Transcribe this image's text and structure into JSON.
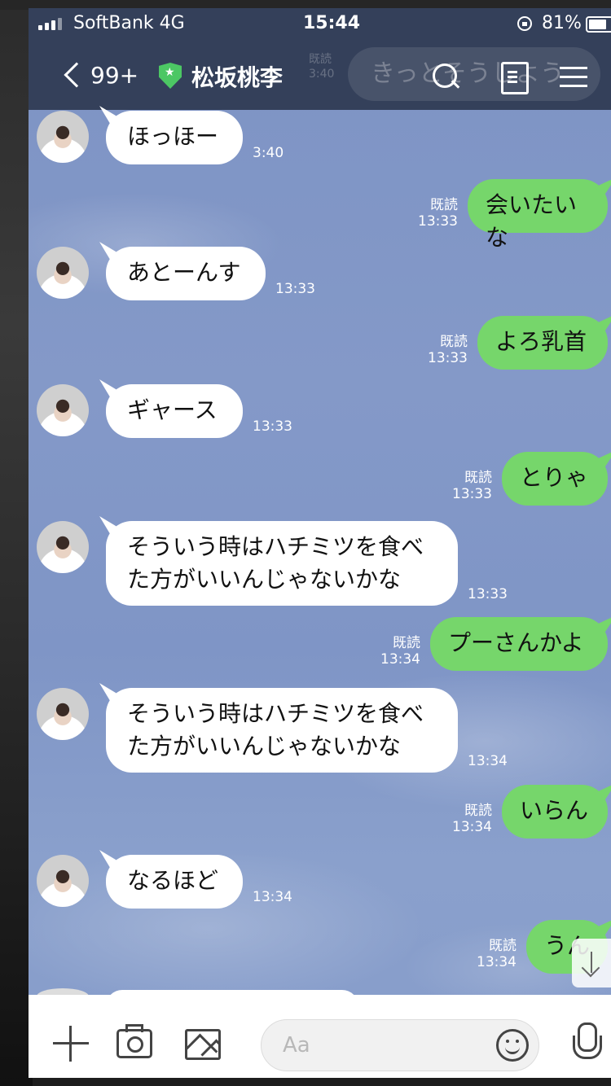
{
  "status_bar": {
    "carrier": "SoftBank  4G",
    "time": "15:44",
    "battery": "81%",
    "signal_icon": "signal-icon",
    "rotation_lock_icon": "rotation-lock-icon"
  },
  "header": {
    "back_count": "99+",
    "title": "松坂桃李",
    "official_badge_icon": "shield-star-icon",
    "ghost_message": "きっとそうしよう",
    "ghost_time": "既読\n3:40",
    "icons": [
      "search-icon",
      "note-icon",
      "menu-icon"
    ]
  },
  "messages": [
    {
      "dir": "in",
      "text": "ほっほー",
      "time": "3:40"
    },
    {
      "dir": "out",
      "text": "会いたいな",
      "read": "既読",
      "time": "13:33"
    },
    {
      "dir": "in",
      "text": "あとーんす",
      "time": "13:33"
    },
    {
      "dir": "out",
      "text": "よろ乳首",
      "read": "既読",
      "time": "13:33"
    },
    {
      "dir": "in",
      "text": "ギャース",
      "time": "13:33"
    },
    {
      "dir": "out",
      "text": "とりゃ",
      "read": "既読",
      "time": "13:33"
    },
    {
      "dir": "in",
      "text": "そういう時はハチミツを食べ\nた方がいいんじゃないかな",
      "time": "13:33"
    },
    {
      "dir": "out",
      "text": "プーさんかよ",
      "read": "既読",
      "time": "13:34"
    },
    {
      "dir": "in",
      "text": "そういう時はハチミツを食べ\nた方がいいんじゃないかな",
      "time": "13:34"
    },
    {
      "dir": "out",
      "text": "いらん",
      "read": "既読",
      "time": "13:34"
    },
    {
      "dir": "in",
      "text": "なるほど",
      "time": "13:34"
    },
    {
      "dir": "out",
      "text": "うん",
      "read": "既読",
      "time": "13:34"
    }
  ],
  "input_bar": {
    "placeholder": "Aa",
    "icons": [
      "plus-icon",
      "camera-icon",
      "image-icon",
      "emoji-icon",
      "mic-icon"
    ]
  },
  "colors": {
    "header_bg": "#34405a",
    "outgoing_bubble": "#76d66b",
    "incoming_bubble": "#ffffff",
    "chat_bg": "#8097c6"
  }
}
